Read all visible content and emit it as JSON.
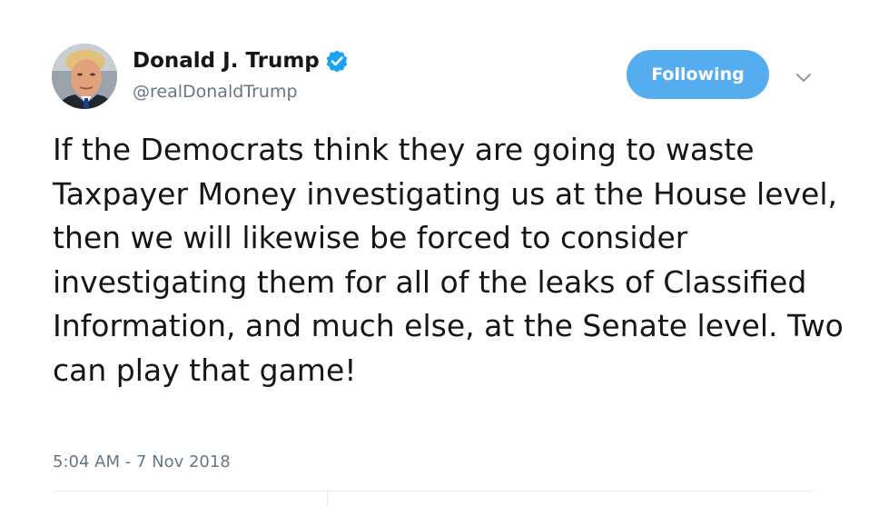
{
  "author": {
    "name": "Donald J. Trump",
    "handle": "@realDonaldTrump",
    "verified": true,
    "avatar_icon": "profile-photo"
  },
  "follow_button": {
    "label": "Following",
    "color": "#55acee"
  },
  "menu_icon": "chevron-down-icon",
  "tweet": {
    "text": "If the Democrats think they are going to waste Taxpayer Money investigating us at the House level, then we will likewise be forced to consider investigating them for all of the leaks of Classified Information, and much else, at the Senate level. Two can play that game!",
    "timestamp": "5:04 AM - 7 Nov 2018"
  },
  "colors": {
    "verified_badge": "#1da1f2",
    "secondary_text": "#657786",
    "primary_text": "#14171a"
  }
}
